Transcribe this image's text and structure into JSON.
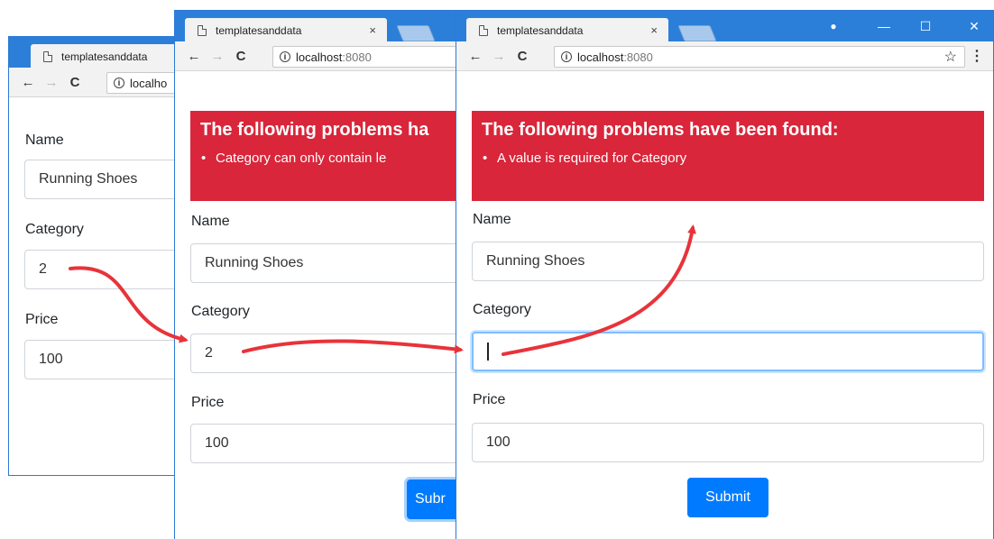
{
  "browser": {
    "tab_title": "templatesanddata",
    "tab_close": "×",
    "url_host": "localhost",
    "url_port": ":8080",
    "back": "←",
    "forward": "→",
    "reload": "C",
    "star": "☆",
    "menu": "⋮",
    "info": "i",
    "account": "●",
    "minimize": "—",
    "maximize": "☐",
    "close": "✕"
  },
  "window1": {
    "address": "localho",
    "name_label": "Name",
    "name_value": "Running Shoes",
    "category_label": "Category",
    "category_value": "2",
    "price_label": "Price",
    "price_value": "100"
  },
  "window2": {
    "address": "localhost",
    "alert_title": "The following problems ha",
    "alert_item": "Category can only contain le",
    "name_label": "Name",
    "name_value": "Running Shoes",
    "category_label": "Category",
    "category_value": "2",
    "price_label": "Price",
    "price_value": "100",
    "submit": "Subr"
  },
  "window3": {
    "address": "localhost",
    "alert_title": "The following problems have been found:",
    "alert_item": "A value is required for Category",
    "name_label": "Name",
    "name_value": "Running Shoes",
    "category_label": "Category",
    "category_value": "",
    "price_label": "Price",
    "price_value": "100",
    "submit": "Submit"
  },
  "colors": {
    "chrome_blue": "#2b7fd9",
    "alert_red": "#d9263a",
    "button_blue": "#007bff",
    "arrow_red": "#e8333a",
    "focus_ring": "#80bdff"
  }
}
